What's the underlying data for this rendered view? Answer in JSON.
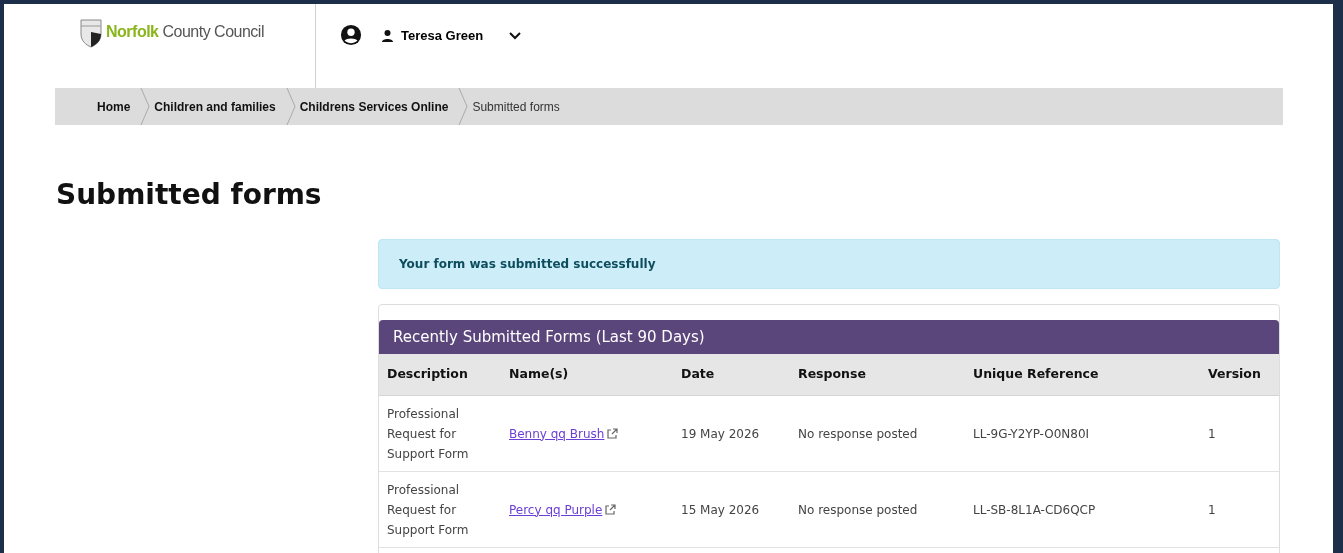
{
  "header": {
    "logo": {
      "brand": "Norfolk",
      "rest": "County Council"
    },
    "user": {
      "name": "Teresa Green"
    }
  },
  "breadcrumb": [
    {
      "label": "Home",
      "current": false
    },
    {
      "label": "Children and families",
      "current": false
    },
    {
      "label": "Childrens Services Online",
      "current": false
    },
    {
      "label": "Submitted forms",
      "current": true
    }
  ],
  "page_title": "Submitted forms",
  "alert": "Your form was submitted successfully",
  "table": {
    "title": "Recently Submitted Forms (Last 90 Days)",
    "columns": [
      "Description",
      "Name(s)",
      "Date",
      "Response",
      "Unique Reference",
      "Version"
    ],
    "rows": [
      {
        "description": "Professional Request for Support Form",
        "name": "Benny qq Brush",
        "date": "19 May 2026",
        "response": "No response posted",
        "reference": "LL-9G-Y2YP-O0N80I",
        "version": "1"
      },
      {
        "description": "Professional Request for Support Form",
        "name": "Percy qq Purple",
        "date": "15 May 2026",
        "response": "No response posted",
        "reference": "LL-SB-8L1A-CD6QCP",
        "version": "1"
      }
    ]
  }
}
